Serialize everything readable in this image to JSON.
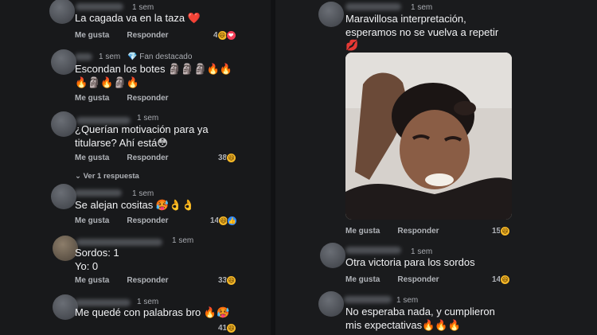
{
  "left": {
    "comments": [
      {
        "time": "1 sem",
        "text": "La cagada va en la taza ❤️",
        "like": "Me gusta",
        "reply": "Responder",
        "count": "4",
        "reacts": [
          "haha",
          "love"
        ]
      },
      {
        "time": "1 sem",
        "badge": "💎 Fan destacado",
        "text": "Escondan los botes 🗿🗿🗿🔥🔥\n🔥🗿🔥🗿🔥",
        "like": "Me gusta",
        "reply": "Responder"
      },
      {
        "time": "1 sem",
        "text": "¿Querían motivación para ya\ntitularse? Ahí está😳",
        "like": "Me gusta",
        "reply": "Responder",
        "count": "38",
        "reacts": [
          "haha"
        ],
        "replies_link": "⌄ Ver 1 respuesta"
      },
      {
        "time": "1 sem",
        "text": "Se alejan cositas 🥵👌👌",
        "like": "Me gusta",
        "reply": "Responder",
        "count": "14",
        "reacts": [
          "haha",
          "like"
        ]
      },
      {
        "time": "1 sem",
        "text": "Sordos: 1\nYo: 0",
        "like": "Me gusta",
        "reply": "Responder",
        "count": "33",
        "reacts": [
          "haha"
        ]
      },
      {
        "time": "1 sem",
        "text": "Me quedé con palabras bro 🔥🥵",
        "like": "Me gusta",
        "reply": "Responder",
        "count": "41",
        "reacts": [
          "haha"
        ]
      }
    ]
  },
  "right": {
    "comments": [
      {
        "time": "1 sem",
        "text": "Maravillosa interpretación,\nesperamos no se vuelva a repetir\n💋",
        "like": "Me gusta",
        "reply": "Responder",
        "count": "15",
        "reacts": [
          "haha"
        ]
      },
      {
        "time": "1 sem",
        "text": "Otra victoria para los sordos",
        "like": "Me gusta",
        "reply": "Responder",
        "count": "14",
        "reacts": [
          "haha"
        ]
      },
      {
        "time": "1 sem",
        "text": "No esperaba nada, y cumplieron\nmis expectativas🔥🔥🔥"
      }
    ]
  }
}
